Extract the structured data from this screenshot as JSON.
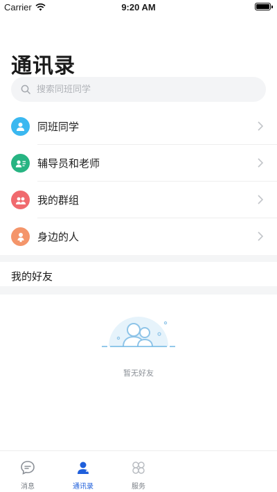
{
  "status_bar": {
    "carrier": "Carrier",
    "time": "9:20 AM"
  },
  "header": {
    "title": "通讯录"
  },
  "search": {
    "placeholder": "搜索同班同学"
  },
  "menu": {
    "items": [
      {
        "label": "同班同学",
        "icon": "classmates-icon",
        "color": "#3bb8f0"
      },
      {
        "label": "辅导员和老师",
        "icon": "teacher-card-icon",
        "color": "#27b482"
      },
      {
        "label": "我的群组",
        "icon": "group-icon",
        "color": "#f06a6e"
      },
      {
        "label": "身边的人",
        "icon": "location-people-icon",
        "color": "#f4956a"
      }
    ]
  },
  "friends": {
    "title": "我的好友",
    "empty_text": "暂无好友"
  },
  "tabbar": {
    "tabs": [
      {
        "label": "消息",
        "icon": "message-icon",
        "active": false
      },
      {
        "label": "通讯录",
        "icon": "contacts-icon",
        "active": true
      },
      {
        "label": "服务",
        "icon": "services-icon",
        "active": false
      }
    ]
  },
  "colors": {
    "accent": "#1f5fdb",
    "background_gap": "#f4f5f6"
  }
}
